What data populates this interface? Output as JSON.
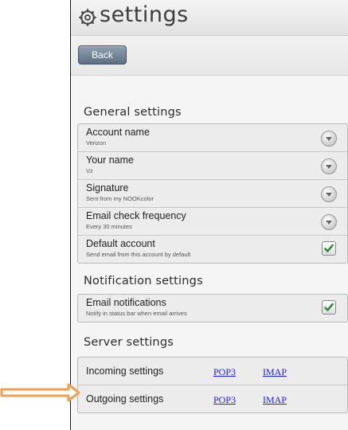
{
  "title": "settings",
  "toolbar": {
    "back_label": "Back"
  },
  "general": {
    "heading": "General settings",
    "rows": [
      {
        "title": "Account name",
        "subtitle": "Verizon",
        "control": "dropdown"
      },
      {
        "title": "Your name",
        "subtitle": "Vz",
        "control": "dropdown"
      },
      {
        "title": "Signature",
        "subtitle": "Sent from my NOOKcolor",
        "control": "dropdown"
      },
      {
        "title": "Email check frequency",
        "subtitle": "Every 30 minutes",
        "control": "dropdown"
      },
      {
        "title": "Default account",
        "subtitle": "Send email from this account by default",
        "control": "checkbox",
        "checked": true
      }
    ]
  },
  "notification": {
    "heading": "Notification settings",
    "rows": [
      {
        "title": "Email notifications",
        "subtitle": "Notify in status bar when email arrives",
        "control": "checkbox",
        "checked": true
      }
    ]
  },
  "server": {
    "heading": "Server settings",
    "rows": [
      {
        "label": "Incoming settings",
        "link1": "POP3",
        "link2": "IMAP"
      },
      {
        "label": "Outgoing settings",
        "link1": "POP3",
        "link2": "IMAP"
      }
    ]
  },
  "colors": {
    "check": "#2e8b3a",
    "arrow": "#f0a050",
    "back_button": "#6f8296",
    "link": "#1a1aff"
  },
  "icons": {
    "title": "gear-icon",
    "pointer": "arrow-right-icon"
  }
}
